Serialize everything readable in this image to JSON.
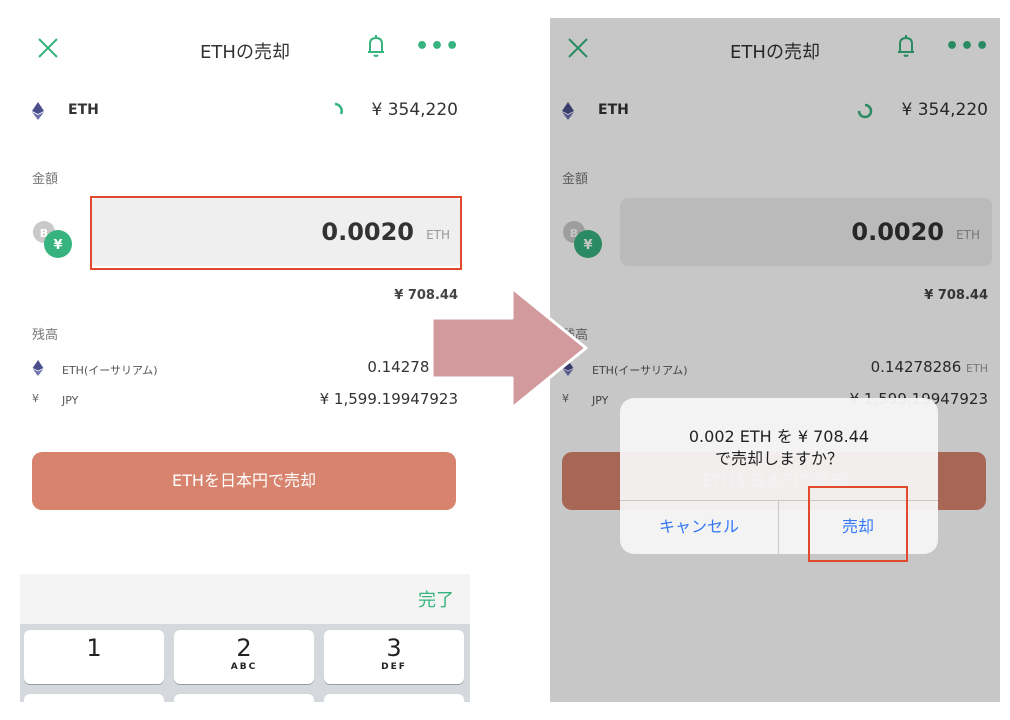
{
  "screen": {
    "title": "ETHの売却",
    "asset": "ETH",
    "price": "¥ 354,220",
    "amount_label": "金額",
    "amount_value": "0.0020",
    "amount_unit": "ETH",
    "yen_value": "¥ 708.44",
    "balance_label": "残高",
    "balances": [
      {
        "name": "ETH(イーサリアム)",
        "value": "0.14278286",
        "unit": "ETH"
      },
      {
        "name": "JPY",
        "value": "¥ 1,599.19947923",
        "unit": ""
      }
    ],
    "sell_button": "ETHを日本円で売却",
    "keyboard_done": "完了",
    "keys": [
      {
        "num": "1",
        "sub": ""
      },
      {
        "num": "2",
        "sub": "ABC"
      },
      {
        "num": "3",
        "sub": "DEF"
      }
    ]
  },
  "dialog": {
    "message_line1": "0.002 ETH を ¥ 708.44",
    "message_line2": "で売却しますか？",
    "cancel": "キャンセル",
    "confirm": "売却"
  },
  "colors": {
    "accent_green": "#36b37e",
    "sell_button": "#d8836d",
    "highlight_red": "#e04a2d",
    "arrow": "#d29a9c",
    "ios_blue": "#3478f6"
  }
}
